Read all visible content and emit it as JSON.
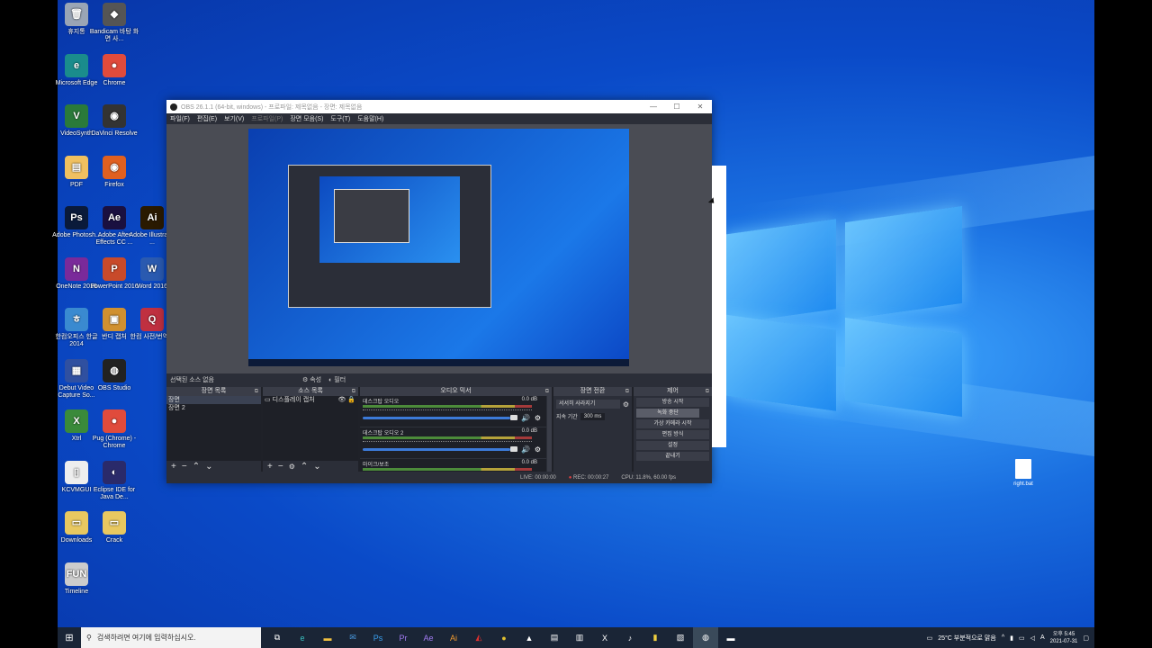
{
  "desktop_icons": [
    {
      "label": "휴지통",
      "color": "#9aa5b5",
      "glyph": "🗑"
    },
    {
      "label": "Bandicam 바탕 화면 사...",
      "color": "#555",
      "glyph": "◆"
    },
    {
      "label": "Microsoft Edge",
      "color": "#1a8c8c",
      "glyph": "e"
    },
    {
      "label": "Chrome",
      "color": "#e04b3c",
      "glyph": "●"
    },
    {
      "label": "VideoSynth",
      "color": "#2a7a3a",
      "glyph": "V"
    },
    {
      "label": "DaVinci Resolve",
      "color": "#333",
      "glyph": "◉"
    },
    {
      "label": "PDF",
      "color": "#f0c060",
      "glyph": "▤"
    },
    {
      "label": "Firefox",
      "color": "#e06020",
      "glyph": "◉"
    },
    {
      "label": "Adobe Photosh...",
      "color": "#0a1a3a",
      "glyph": "Ps"
    },
    {
      "label": "Adobe After Effects CC ...",
      "color": "#1a1040",
      "glyph": "Ae"
    },
    {
      "label": "Adobe Illustrator ...",
      "color": "#2a1a00",
      "glyph": "Ai"
    },
    {
      "label": "OneNote 2016",
      "color": "#7a2a9a",
      "glyph": "N"
    },
    {
      "label": "PowerPoint 2016",
      "color": "#c84a2a",
      "glyph": "P"
    },
    {
      "label": "Word 2016",
      "color": "#2a5ab0",
      "glyph": "W"
    },
    {
      "label": "한컴오피스 한글 2014",
      "color": "#3a8ad0",
      "glyph": "ㅎ"
    },
    {
      "label": "반디 캡처",
      "color": "#d09030",
      "glyph": "▣"
    },
    {
      "label": "한컴 사전/번역기",
      "color": "#c03040",
      "glyph": "Q"
    },
    {
      "label": "Debut Video Capture So...",
      "color": "#3050a0",
      "glyph": "▦"
    },
    {
      "label": "OBS Studio",
      "color": "#222",
      "glyph": "◍"
    },
    {
      "label": "Xtrl",
      "color": "#3a8a3a",
      "glyph": "X"
    },
    {
      "label": "Pug (Chrome) - Chrome",
      "color": "#e04b3c",
      "glyph": "●"
    },
    {
      "label": "KCVMGUI",
      "color": "#eee",
      "glyph": "▯"
    },
    {
      "label": "Eclipse IDE for Java De...",
      "color": "#2a2a6a",
      "glyph": "◐"
    },
    {
      "label": "Downloads",
      "color": "#e8c860",
      "glyph": "▭"
    },
    {
      "label": "Crack",
      "color": "#e8c860",
      "glyph": "▭"
    },
    {
      "label": "Timeline",
      "color": "#ccc",
      "glyph": "FUN"
    }
  ],
  "obs": {
    "title": "OBS 26.1.1 (64-bit, windows) - 프로파일: 제목없음 - 장면: 제목없음",
    "menu": [
      "파일(F)",
      "편집(E)",
      "보기(V)",
      "프로파일(P)",
      "장면 모음(S)",
      "도구(T)",
      "도움말(H)"
    ],
    "context_label": "선택된 소스 없음",
    "context_props": "속성",
    "context_filters": "필터",
    "docks": {
      "scenes": {
        "header": "장면 목록",
        "items": [
          "장면",
          "장면 2"
        ]
      },
      "sources": {
        "header": "소스 목록",
        "items": [
          "디스플레이 캡처"
        ]
      },
      "mixer": {
        "header": "오디오 믹서",
        "channels": [
          {
            "name": "데스크탑 오디오",
            "db": "0.0 dB"
          },
          {
            "name": "데스크탑 오디오 2",
            "db": "0.0 dB"
          },
          {
            "name": "마이크/보조",
            "db": "0.0 dB"
          }
        ]
      },
      "transitions": {
        "header": "장면 전환",
        "transition": "서서히 사라지기",
        "duration_label": "지속 기간",
        "duration": "300 ms"
      },
      "controls": {
        "header": "제어",
        "buttons": [
          "방송 시작",
          "녹화 중단",
          "가상 카메라 시작",
          "편집 방식",
          "설정",
          "끝내기"
        ]
      }
    },
    "status": {
      "live": "LIVE: 00:00:00",
      "rec": "REC: 00:00:27",
      "cpu": "CPU: 11.8%, 60.00 fps"
    }
  },
  "desktop_file": {
    "label": "right.bat"
  },
  "taskbar": {
    "search_placeholder": "검색하려면 여기에 입력하십시오.",
    "weather": "25°C 부분적으로 맑음",
    "time": "오후 5:45",
    "date": "2021-07-31",
    "lang": "A"
  }
}
